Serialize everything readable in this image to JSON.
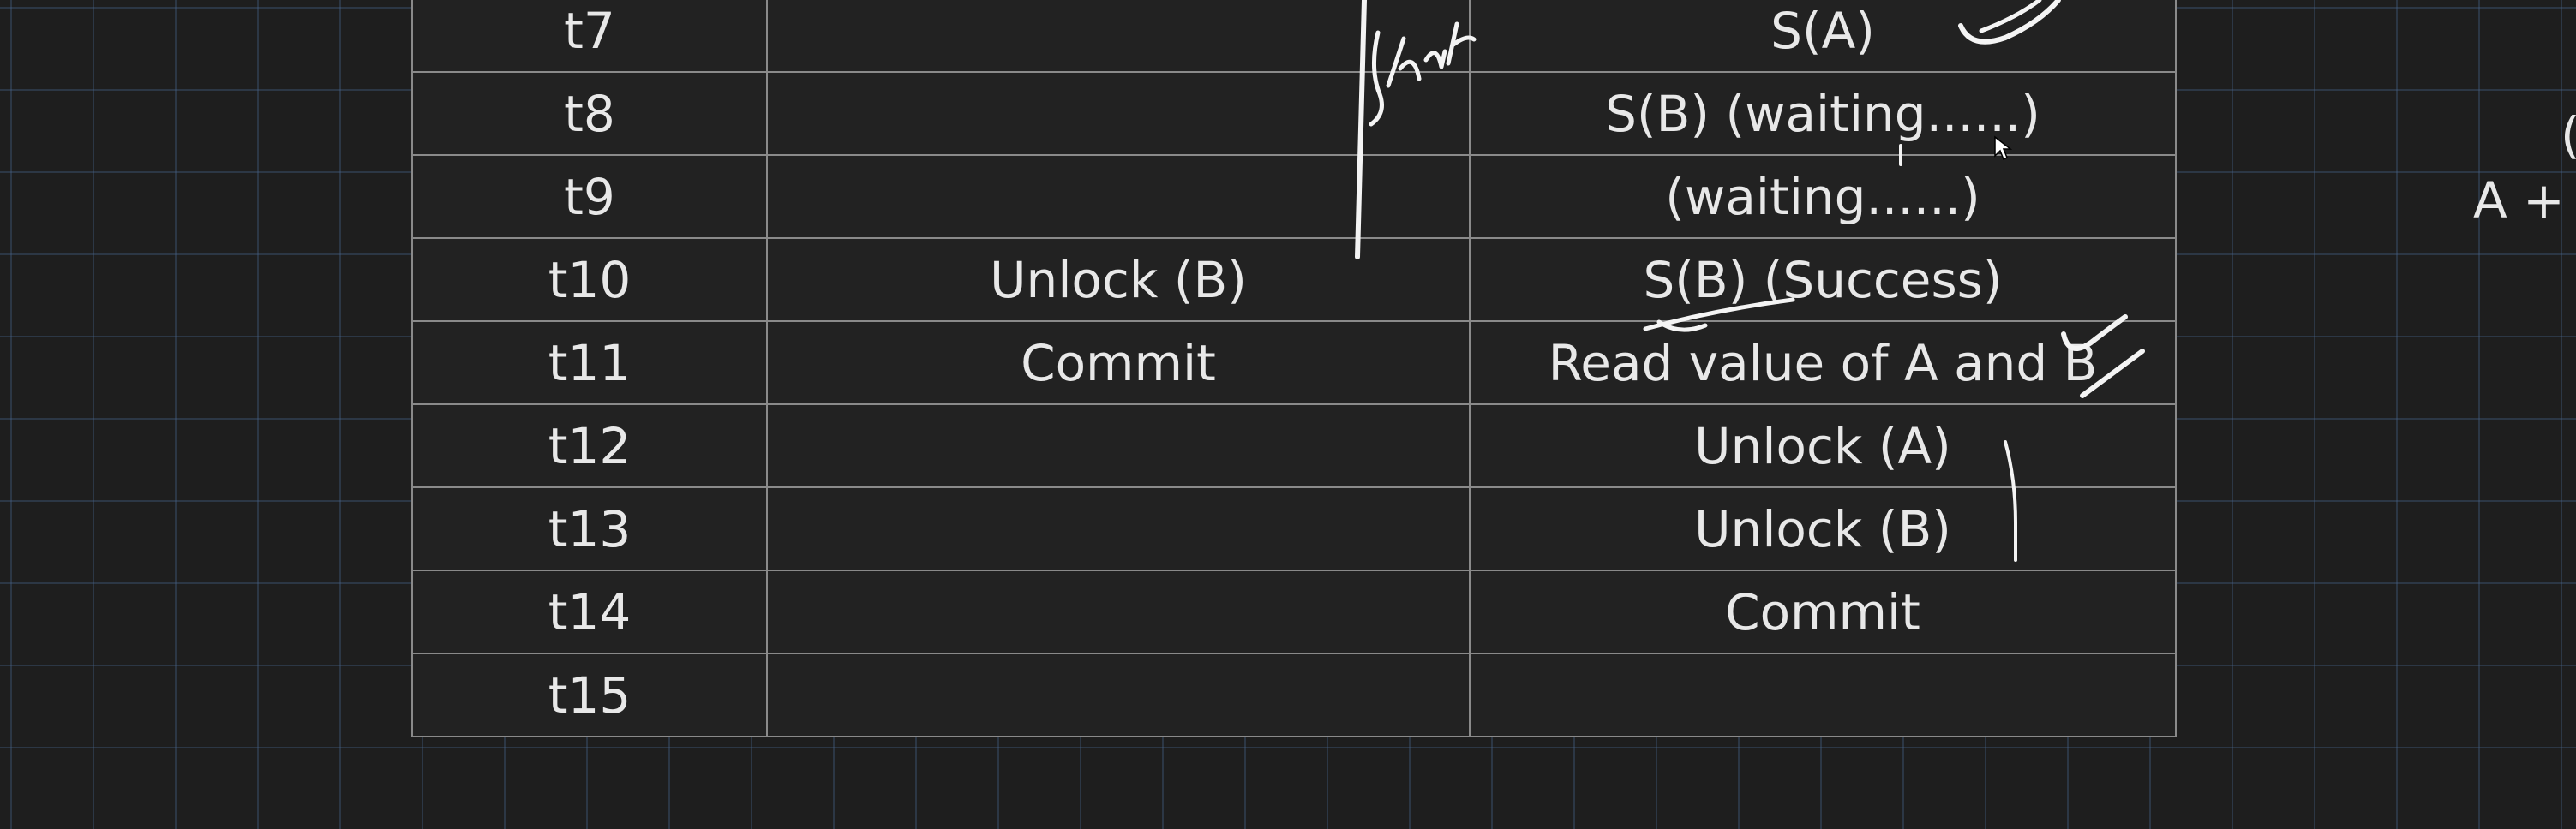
{
  "table": {
    "rows": [
      {
        "time": "t7",
        "t1": "",
        "t2": "S(A)"
      },
      {
        "time": "t8",
        "t1": "",
        "t2": "S(B) (waiting......)"
      },
      {
        "time": "t9",
        "t1": "",
        "t2": "(waiting......)"
      },
      {
        "time": "t10",
        "t1": "Unlock (B)",
        "t2": "S(B)  (Success)"
      },
      {
        "time": "t11",
        "t1": "Commit",
        "t2": "Read value of A and B"
      },
      {
        "time": "t12",
        "t1": "",
        "t2": "Unlock (A)"
      },
      {
        "time": "t13",
        "t1": "",
        "t2": "Unlock (B)"
      },
      {
        "time": "t14",
        "t1": "",
        "t2": "Commit"
      },
      {
        "time": "t15",
        "t1": "",
        "t2": ""
      }
    ]
  },
  "edge_text": {
    "line1": "A + I",
    "partial": "("
  },
  "annotation": {
    "handwritten_word": "Shar"
  },
  "colors": {
    "background": "#1e1e1e",
    "grid": "#46648c",
    "table_border": "#8a8a8a",
    "text": "#e8e8e8",
    "ink": "#f4f4f4"
  }
}
